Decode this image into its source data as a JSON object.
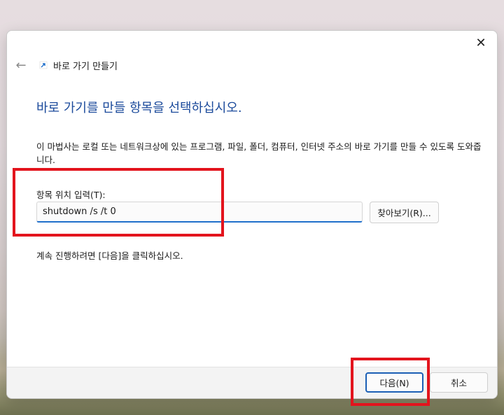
{
  "window": {
    "title": "바로 가기 만들기",
    "close_glyph": "✕",
    "back_glyph": "←"
  },
  "main": {
    "headline": "바로 가기를 만들 항목을 선택하십시오.",
    "description": "이 마법사는 로컬 또는 네트워크상에 있는 프로그램, 파일, 폴더, 컴퓨터, 인터넷 주소의 바로 가기를 만들 수 있도록 도와줍니다.",
    "field_label": "항목 위치 입력(T):",
    "location_value": "shutdown /s /t 0",
    "browse_label": "찾아보기(R)...",
    "hint": "계속 진행하려면 [다음]을 클릭하십시오."
  },
  "footer": {
    "next_label": "다음(N)",
    "cancel_label": "취소"
  },
  "colors": {
    "headline": "#1b4a9b",
    "accent": "#1f6fcb",
    "annotation": "#e3141d"
  },
  "icons": {
    "back": "back-arrow-icon",
    "close": "close-icon",
    "wizard": "shortcut-icon"
  }
}
